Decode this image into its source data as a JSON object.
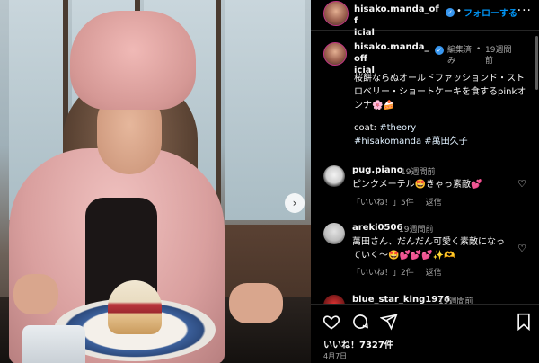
{
  "post": {
    "username_line1": "hisako.manda_off",
    "username_line2": "icial",
    "follow_dot": "•",
    "follow_label": "フォローする",
    "more_label": "···"
  },
  "caption": {
    "username_line1": "hisako.manda_off",
    "username_line2": "icial",
    "edited": "編集済み",
    "dot": "•",
    "time": "19週間前",
    "text": "桜餅ならぬオールドファッションド・ストロベリー・ショートケーキを食するpinkオンナ🌸🍰",
    "coat_label": "coat: ",
    "coat_tag": "#theory",
    "tags": "#hisakomanda #萬田久子"
  },
  "comments": [
    {
      "username": "pug.piano",
      "time": "19週間前",
      "text": "ピンクメーテル🤩きゃっ素敵💕",
      "likes": "「いいね！」5件",
      "reply": "返信"
    },
    {
      "username": "areki0506",
      "time": "19週間前",
      "text": "萬田さん、だんだん可愛く素敵になっていく〜🤩💕💕💕✨🫶",
      "likes": "「いいね！」2件",
      "reply": "返信"
    },
    {
      "username": "blue_star_king1976",
      "time": "19週間前"
    }
  ],
  "footer": {
    "likes": "いいね！7327件",
    "date": "4月7日"
  },
  "colors": {
    "accent": "#0095f6",
    "verified": "#3897f0",
    "hashtag": "#e0f1ff",
    "muted": "#a8a8a8"
  }
}
